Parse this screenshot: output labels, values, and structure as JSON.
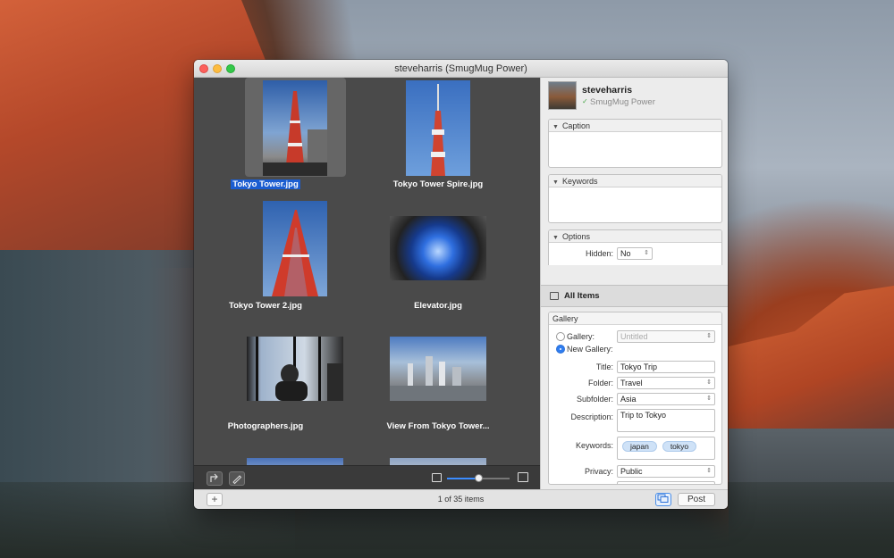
{
  "window": {
    "title": "steveharris (SmugMug Power)"
  },
  "browser": {
    "photos": [
      {
        "name": "Tokyo Tower.jpg",
        "selected": true
      },
      {
        "name": "Tokyo Tower Spire.jpg",
        "selected": false
      },
      {
        "name": "Tokyo Tower 2.jpg",
        "selected": false
      },
      {
        "name": "Elevator.jpg",
        "selected": false
      },
      {
        "name": "Photographers.jpg",
        "selected": false
      },
      {
        "name": "View From Tokyo Tower...",
        "selected": false
      }
    ],
    "zoom_level": 0.5
  },
  "status": {
    "count_text": "1 of 35 items",
    "post_label": "Post"
  },
  "account": {
    "name": "steveharris",
    "type": "SmugMug Power"
  },
  "panels": {
    "caption_label": "Caption",
    "keywords_label": "Keywords",
    "options_label": "Options",
    "hidden_label": "Hidden:",
    "hidden_value": "No"
  },
  "all_items_label": "All Items",
  "gallery": {
    "header": "Gallery",
    "gallery_radio_label": "Gallery:",
    "gallery_value": "Untitled",
    "new_gallery_label": "New Gallery:",
    "title_label": "Title:",
    "title_value": "Tokyo Trip",
    "folder_label": "Folder:",
    "folder_value": "Travel",
    "subfolder_label": "Subfolder:",
    "subfolder_value": "Asia",
    "description_label": "Description:",
    "description_value": "Trip to Tokyo",
    "keywords_label": "Keywords:",
    "keywords": [
      "japan",
      "tokyo"
    ],
    "privacy_label": "Privacy:",
    "privacy_value": "Public"
  }
}
